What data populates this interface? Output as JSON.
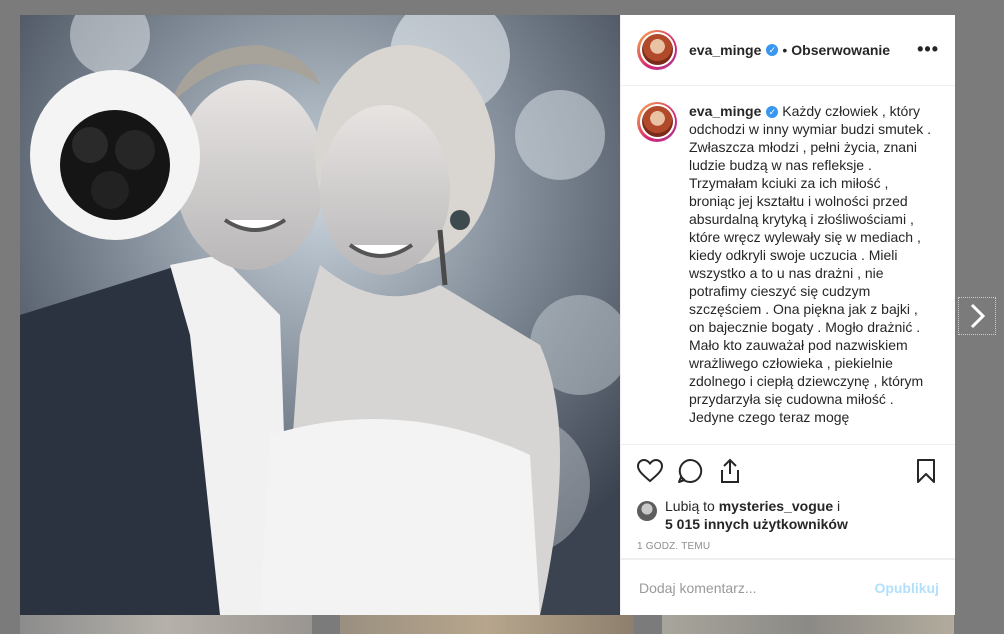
{
  "header": {
    "username": "eva_minge",
    "follow_state": "Obserwowanie",
    "separator": "•",
    "more_label": "•••"
  },
  "caption": {
    "username": "eva_minge",
    "text": "Każdy człowiek , który odchodzi w inny wymiar budzi smutek . Zwłaszcza młodzi , pełni życia, znani ludzie budzą w nas refleksje . Trzymałam kciuki za ich miłość , broniąc jej kształtu i wolności przed absurdalną krytyką i złośliwościami , które wręcz wylewały się w mediach , kiedy odkryli swoje uczucia . Mieli wszystko a to u nas drażni , nie potrafimy cieszyć się cudzym szczęściem . Ona piękna jak z bajki , on bajecznie bogaty . Mogło drażnić . Mało kto zauważał pod nazwiskiem wrażliwego człowieka , piekielnie zdolnego i ciepłą dziewczynę , którym przydarzyła się cudowna miłość . Jedyne czego teraz mogę"
  },
  "likes": {
    "prefix": "Lubią to",
    "user": "mysteries_vogue",
    "conj": "i",
    "others": "5 015 innych użytkowników"
  },
  "time_ago": "1 godz. temu",
  "comment": {
    "placeholder": "Dodaj komentarz...",
    "publish_label": "Opublikuj"
  },
  "icons": [
    "heart-icon",
    "comment-icon",
    "share-icon",
    "bookmark-icon",
    "chevron-right-icon",
    "verified-icon"
  ],
  "colors": {
    "verified": "#3897f0",
    "publish_disabled": "#b2dffc",
    "text": "#262626",
    "muted": "#8e8e8e"
  }
}
